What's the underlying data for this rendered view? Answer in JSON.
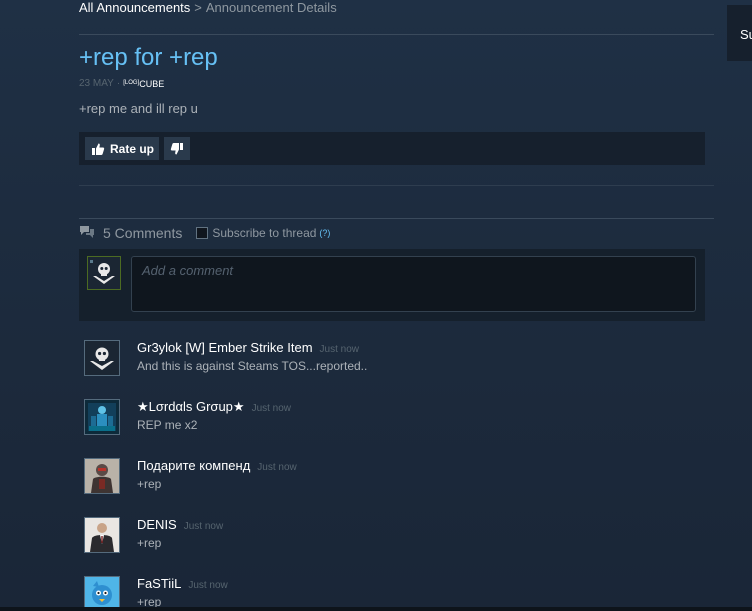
{
  "breadcrumb": {
    "root": "All Announcements",
    "separator": ">",
    "current": "Announcement Details"
  },
  "side_tab": {
    "label": "Su"
  },
  "post": {
    "title": "+rep for +rep",
    "date": "23 MAY",
    "dot": "·",
    "author_tag": "[LOG]",
    "author_name": "CUBE",
    "body": "+rep me and ill rep u"
  },
  "rating": {
    "rate_up_label": "Rate up",
    "rate_up_icon": "thumbs-up-icon",
    "rate_down_icon": "thumbs-down-icon"
  },
  "comments_header": {
    "count_label": "5 Comments",
    "subscribe_label": "Subscribe to thread",
    "help_label": "(?)",
    "subscribed": false
  },
  "composer": {
    "placeholder": "Add a comment"
  },
  "comments": [
    {
      "author": "Gr3ylok [W] Ember Strike Item",
      "time": "Just now",
      "text": "And this is against Steams TOS...reported..",
      "avatar": "skull-emblem"
    },
    {
      "author": "★Lσrdαls Grσup★",
      "time": "Just now",
      "text": "REP me x2",
      "avatar": "blue-figure"
    },
    {
      "author": "Подарите компенд",
      "time": "Just now",
      "text": "+rep",
      "avatar": "armored-figure"
    },
    {
      "author": "DENIS",
      "time": "Just now",
      "text": "+rep",
      "avatar": "man-in-suit"
    },
    {
      "author": "FaSTiiL",
      "time": "Just now",
      "text": "+rep",
      "avatar": "blue-creature"
    }
  ],
  "colors": {
    "accent": "#66c0f4",
    "background": "#1b2838",
    "panel": "#16202d"
  }
}
